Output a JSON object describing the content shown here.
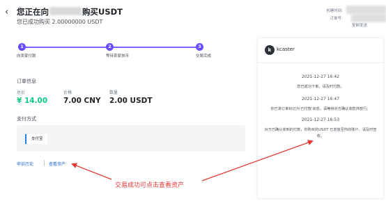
{
  "header": {
    "back_icon": "chevron-left-icon",
    "title_prefix": "您正在向",
    "title_suffix": "购买USDT",
    "subtitle": "您已成功购买 2.00000000 USDT",
    "created_label": "创建时间:",
    "order_no_label": "订单号:",
    "meta_tail": "复制发送"
  },
  "progress": {
    "steps": [
      {
        "num": "1",
        "label": "向卖家付款"
      },
      {
        "num": "2",
        "label": "等待卖家放币"
      },
      {
        "num": "3",
        "label": "交易完成"
      }
    ]
  },
  "order": {
    "section_title": "订单信息",
    "fields": [
      {
        "label": "总价",
        "value": "¥ 14.00"
      },
      {
        "label": "价格",
        "value": "7.00 CNY"
      },
      {
        "label": "数量",
        "value": "2.00 USDT"
      }
    ]
  },
  "payment": {
    "section_title": "支付方式",
    "method": "支付宝"
  },
  "links": {
    "appeal_history": "申诉历史",
    "view_assets": "查看资产"
  },
  "chat": {
    "avatar_letter": "k",
    "username": "kcaster",
    "messages": [
      {
        "time": "2021-12-27 16:42",
        "text": "您已成功下单，请及时付款。"
      },
      {
        "time": "2021-12-27 16:47",
        "text": "你已将订单标记为'已付款'状态，请等待对方确认收款并放行。"
      },
      {
        "time": "2021-12-27 16:53",
        "text": "对方已确认收到的付款，你购买的USDT 已发放至你的账户，请及时查收。"
      }
    ]
  },
  "annotation": {
    "text": "交易成功可点击查看资产",
    "color": "#e53935"
  },
  "colors": {
    "accent": "#6b4bff",
    "total_price": "#0ecb81",
    "link": "#1c64d8"
  }
}
